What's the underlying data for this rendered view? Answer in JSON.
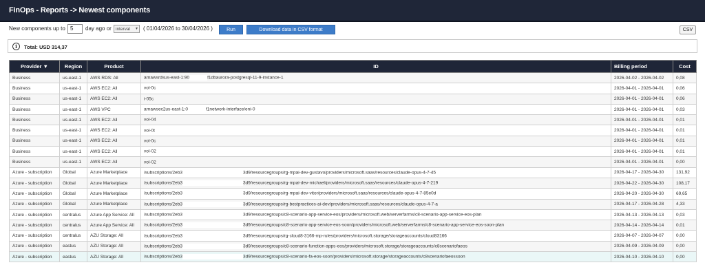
{
  "header": {
    "title": "FinOps - Reports -> Newest components"
  },
  "controls": {
    "label_prefix": "New components up to",
    "days_value": "5",
    "label_suffix": "day ago or",
    "interval_selected": "interval",
    "date_range": "( 01/04/2026  to 30/04/2026 )",
    "run_label": "Run",
    "download_label": "Download data in CSV format",
    "csv_label": "CSV"
  },
  "summary": {
    "total_label": "Total: USD 314,37"
  },
  "table": {
    "headers": [
      "Provider ▼",
      "Region",
      "Product",
      "ID",
      "Billing period",
      "Cost"
    ],
    "rows": [
      {
        "provider": "Business",
        "region": "us-east-1",
        "product": "AWS RDS: All",
        "id_a": "arnawsrdsus-east-1:90",
        "id_b": "f1dbaurora-postgresql-11-9-instance-1",
        "billing": "2026-04-02 - 2026-04-02",
        "cost": "0,08"
      },
      {
        "provider": "Business",
        "region": "us-east-1",
        "product": "AWS EC2: All",
        "id_a": "vol-0c",
        "id_b": "",
        "billing": "2026-04-01 - 2026-04-01",
        "cost": "0,06"
      },
      {
        "provider": "Business",
        "region": "us-east-1",
        "product": "AWS EC2: All",
        "id_a": "i-05c",
        "id_b": "",
        "billing": "2026-04-01 - 2026-04-01",
        "cost": "0,06"
      },
      {
        "provider": "Business",
        "region": "us-east-1",
        "product": "AWS VPC",
        "id_a": "arnawsec2us-east-1:0",
        "id_b": "f1network-interface/eni-0",
        "billing": "2026-04-01 - 2026-04-01",
        "cost": "0,03"
      },
      {
        "provider": "Business",
        "region": "us-east-1",
        "product": "AWS EC2: All",
        "id_a": "vol-04",
        "id_b": "",
        "billing": "2026-04-01 - 2026-04-01",
        "cost": "0,01"
      },
      {
        "provider": "Business",
        "region": "us-east-1",
        "product": "AWS EC2: All",
        "id_a": "vol-0t",
        "id_b": "",
        "billing": "2026-04-01 - 2026-04-01",
        "cost": "0,01"
      },
      {
        "provider": "Business",
        "region": "us-east-1",
        "product": "AWS EC2: All",
        "id_a": "vol-0c",
        "id_b": "",
        "billing": "2026-04-01 - 2026-04-01",
        "cost": "0,01"
      },
      {
        "provider": "Business",
        "region": "us-east-1",
        "product": "AWS EC2: All",
        "id_a": "vol-02",
        "id_b": "",
        "billing": "2026-04-01 - 2026-04-01",
        "cost": "0,01"
      },
      {
        "provider": "Business",
        "region": "us-east-1",
        "product": "AWS EC2: All",
        "id_a": "vol-02",
        "id_b": "",
        "billing": "2026-04-01 - 2026-04-01",
        "cost": "0,00"
      },
      {
        "provider": "Azure - subscription",
        "region": "Global",
        "product": "Azure Marketplace",
        "id_a": "/subscriptions/2eb3",
        "id_b": "3d9/resourcegroups/rg-mpai-dev-gustavo/providers/microsoft.saas/resources/claude-opus-4-7-45",
        "billing": "2026-04-17 - 2026-04-30",
        "cost": "131,92"
      },
      {
        "provider": "Azure - subscription",
        "region": "Global",
        "product": "Azure Marketplace",
        "id_a": "/subscriptions/2eb3",
        "id_b": "3d9/resourcegroups/rg-mpai-dev-michael/providers/microsoft.saas/resources/claude-opus-4-7-219",
        "billing": "2026-04-22 - 2026-04-30",
        "cost": "108,17"
      },
      {
        "provider": "Azure - subscription",
        "region": "Global",
        "product": "Azure Marketplace",
        "id_a": "/subscriptions/2eb3",
        "id_b": "3d9/resourcegroups/rg-mpai-dev-vitor/providers/microsoft.saas/resources/claude-opus-4-7-85e0d",
        "billing": "2026-04-20 - 2026-04-30",
        "cost": "69,65"
      },
      {
        "provider": "Azure - subscription",
        "region": "Global",
        "product": "Azure Marketplace",
        "id_a": "/subscriptions/2eb3",
        "id_b": "3d9/resourcegroups/rg-bestpractices-ai-dev/providers/microsoft.saas/resources/claude-opus-4-7-a",
        "billing": "2026-04-17 - 2026-04-28",
        "cost": "4,33"
      },
      {
        "provider": "Azure - subscription",
        "region": "centralus",
        "product": "Azure App Service: All",
        "id_a": "/subscriptions/2eb3",
        "id_b": "3d9/resourcegroups/c8-scenario-app-service-eos/providers/microsoft.web/serverfarms/c8-scenario-app-service-eos-plan",
        "billing": "2026-04-13 - 2026-04-13",
        "cost": "0,03"
      },
      {
        "provider": "Azure - subscription",
        "region": "centralus",
        "product": "Azure App Service: All",
        "id_a": "/subscriptions/2eb3",
        "id_b": "3d9/resourcegroups/c8-scenario-app-service-eos-soon/providers/microsoft.web/serverfarms/c8-scenario-app-service-eos-soon-plan",
        "billing": "2026-04-14 - 2026-04-14",
        "cost": "0,01"
      },
      {
        "provider": "Azure - subscription",
        "region": "centralus",
        "product": "AZU Storage: All",
        "id_a": "/subscriptions/2eb3",
        "id_b": "3d9/resourcegroups/rg-cloud8-3166-mp-rules/providers/microsoft.storage/storageaccounts/cloud83166",
        "billing": "2026-04-07 - 2026-04-07",
        "cost": "0,00"
      },
      {
        "provider": "Azure - subscription",
        "region": "eastus",
        "product": "AZU Storage: All",
        "id_a": "/subscriptions/2eb3",
        "id_b": "3d9/resourcegroups/c8-scenario-function-apps-eos/providers/microsoft.storage/storageaccounts/c8scenariofaeos",
        "billing": "2026-04-09 - 2026-04-09",
        "cost": "0,00"
      },
      {
        "provider": "Azure - subscription",
        "region": "eastus",
        "product": "AZU Storage: All",
        "id_a": "/subscriptions/2eb3",
        "id_b": "3d9/resourcegroups/c8-scenario-fa-eos-soon/providers/microsoft.storage/storageaccounts/c8scenariofaeossoon",
        "billing": "2026-04-10 - 2026-04-10",
        "cost": "0,00"
      }
    ]
  }
}
